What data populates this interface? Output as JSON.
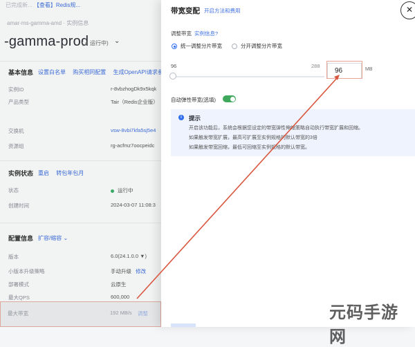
{
  "background": {
    "top_note_prefix": "已完成新...",
    "top_note_link": "【查看】Redis规...",
    "breadcrumb": "amar-ms-gamma-amd · 实例信息",
    "instance_name": "-gamma-prod",
    "instance_state": "( ● 运行中)",
    "basic": {
      "title": "基本信息",
      "links": [
        "设置白名单",
        "购买相同配置",
        "生成OpenAPI请求参数"
      ],
      "rows": [
        {
          "key": "实例ID",
          "value": "r-8vbzhogDk9x5kqk"
        },
        {
          "key": "产品类型",
          "value": "Tair（Redis企业版）"
        },
        {
          "key": "交换机",
          "value": "vsw-8vbi7kfa5sj5e4"
        },
        {
          "key": "资源组",
          "value": "rg-acfmz7oocpeidc"
        }
      ]
    },
    "status": {
      "title": "实例状态",
      "links": [
        "重启",
        "转包年包月"
      ],
      "rows": [
        {
          "key": "状态",
          "value": "运行中"
        },
        {
          "key": "创建时间",
          "value": "2024-03-07 11:08:3"
        }
      ]
    },
    "config": {
      "title": "配置信息",
      "links": [
        "扩容/缩容 ⌄"
      ],
      "rows": [
        {
          "key": "版本",
          "value": "6.0(24.1.0.0 ▼)"
        },
        {
          "key": "小版本升级策略",
          "value": "手动升级",
          "link": "修改"
        },
        {
          "key": "部署模式",
          "value": "云原生"
        },
        {
          "key": "最大QPS",
          "value": "600,000"
        }
      ],
      "highlight_row": {
        "key": "最大带宽",
        "value": "192 MB/s",
        "link": "调整"
      }
    }
  },
  "drawer": {
    "title": "带宽变配",
    "title_link": "开启方法和费用",
    "close_icon": "close-icon",
    "adjust_label": "调整带宽",
    "adjust_link": "实例信息?",
    "radio_options": [
      {
        "label": "统一调整分片带宽",
        "selected": true
      },
      {
        "label": "分开调整分片带宽",
        "selected": false
      }
    ],
    "slider_min": "96",
    "slider_max": "288",
    "slider_level_fraction": 0,
    "bandwidth_value": "96",
    "bandwidth_unit": "MB",
    "auto_label": "自动弹性带宽(选填)",
    "auto_enabled": true,
    "tip": {
      "title": "提示",
      "lines": [
        "开启该功能后，系统会根据您设定的带宽弹性伸缩策略自动执行带宽扩展和回缩。",
        "如果触发带宽扩展，最高可扩展至实例规格的默认带宽的3倍",
        "如果触发带宽回缩，最低可回缩至实例规格的默认带宽。"
      ]
    }
  },
  "watermark": "元码手游网",
  "colors": {
    "accent": "#2f6df0",
    "link": "#3d6fe0",
    "toggle_on": "#3fa85c",
    "annotation": "#d9563f",
    "tip_bg": "#eef3fd"
  }
}
